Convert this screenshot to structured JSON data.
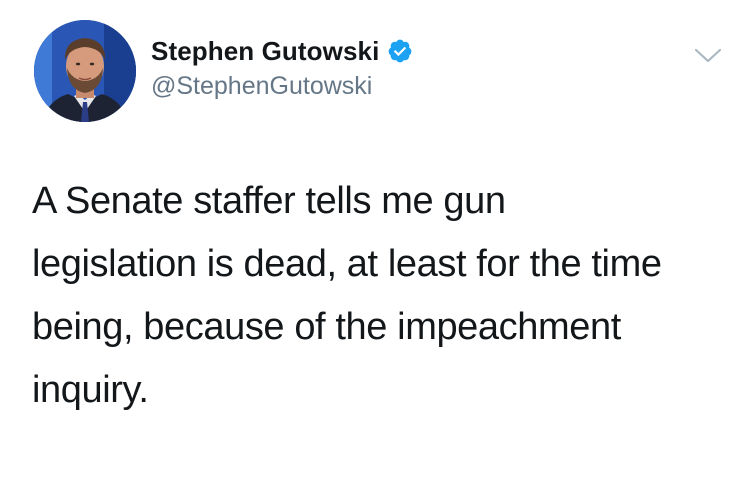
{
  "tweet": {
    "author": {
      "display_name": "Stephen Gutowski",
      "handle": "@StephenGutowski",
      "verified": true,
      "avatar_icon": "profile-photo"
    },
    "menu_icon": "chevron-down-icon",
    "text": "A Senate staffer tells me gun\nlegislation is dead, at least for the time\nbeing, because of the impeachment\ninquiry."
  },
  "colors": {
    "text_primary": "#14171a",
    "text_secondary": "#657786",
    "verified_blue": "#1da1f2",
    "chevron_gray": "#aab8c2"
  }
}
